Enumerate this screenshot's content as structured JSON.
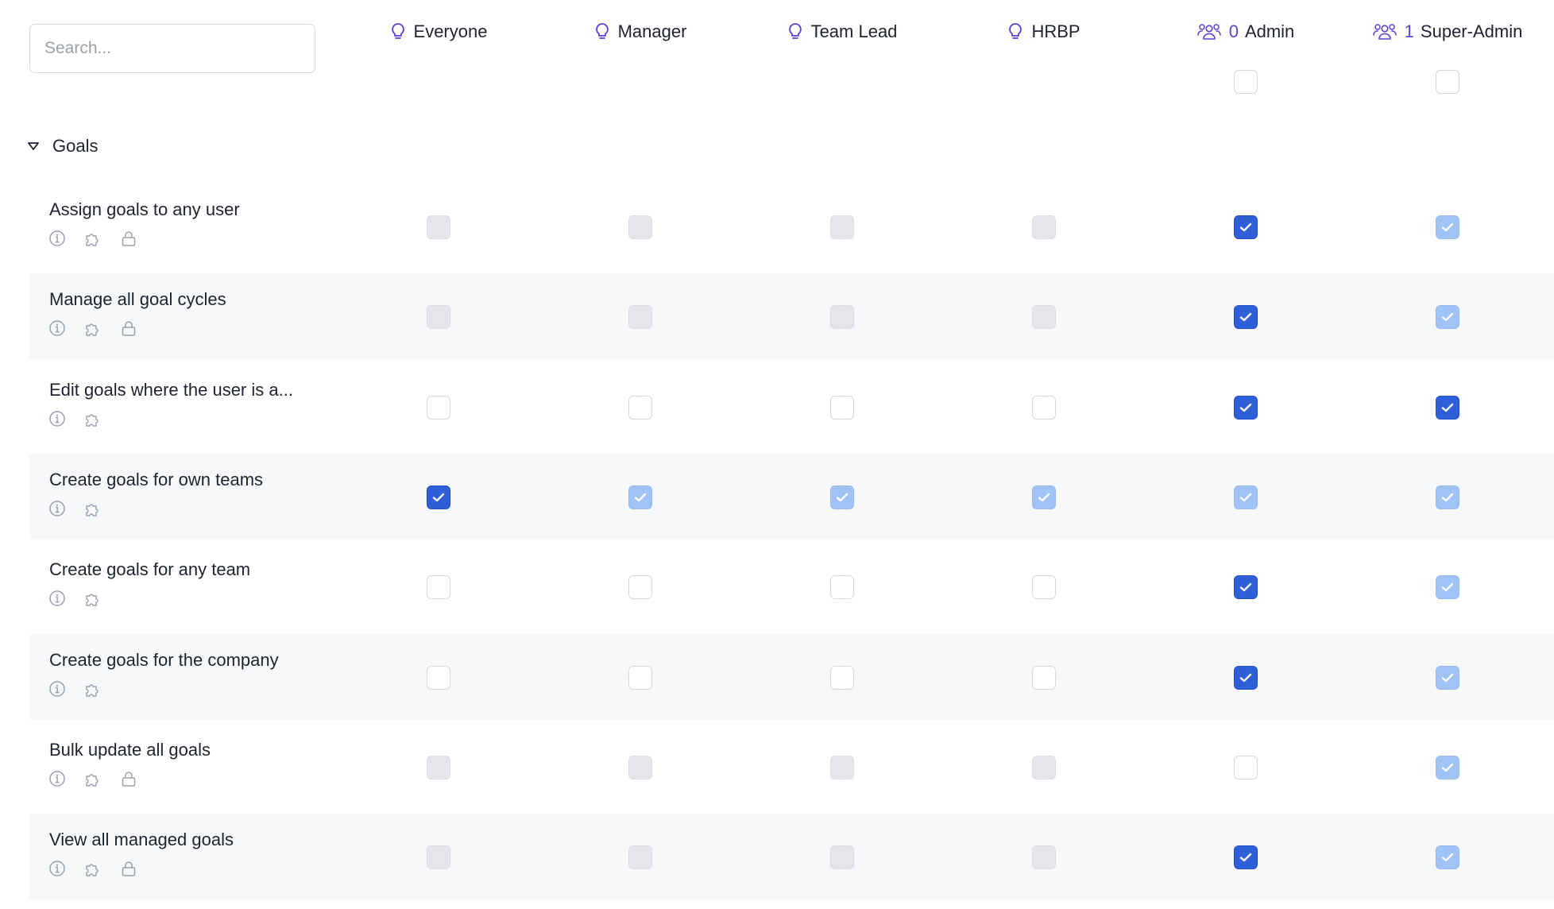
{
  "search": {
    "placeholder": "Search..."
  },
  "colors": {
    "accent_purple": "#5b3fd6",
    "checked_blue": "#2f5fd8",
    "inherited_blue": "#9fc3f5",
    "disabled_gray": "#e4e6ea",
    "row_alt_bg": "#f7f8fa"
  },
  "roles": [
    {
      "label": "Everyone",
      "icon": "lightbulb-icon"
    },
    {
      "label": "Manager",
      "icon": "lightbulb-icon"
    },
    {
      "label": "Team Lead",
      "icon": "lightbulb-icon"
    },
    {
      "label": "HRBP",
      "icon": "lightbulb-icon"
    },
    {
      "label": "Admin",
      "icon": "users-icon",
      "count": "0"
    },
    {
      "label": "Super-Admin",
      "icon": "users-icon",
      "count": "1"
    }
  ],
  "header_checkboxes": [
    {
      "role": "Admin",
      "state": "empty"
    },
    {
      "role": "Super-Admin",
      "state": "empty"
    }
  ],
  "section": {
    "title": "Goals",
    "expanded": true,
    "icon": "caret-down-icon"
  },
  "permissions": [
    {
      "label": "Assign goals to any user",
      "icons": [
        "info-icon",
        "puzzle-icon",
        "lock-icon"
      ],
      "states": [
        "disabled",
        "disabled",
        "disabled",
        "disabled",
        "checked",
        "inherited"
      ]
    },
    {
      "label": "Manage all goal cycles",
      "icons": [
        "info-icon",
        "puzzle-icon",
        "lock-icon"
      ],
      "states": [
        "disabled",
        "disabled",
        "disabled",
        "disabled",
        "checked",
        "inherited"
      ]
    },
    {
      "label": "Edit goals where the user is a...",
      "icons": [
        "info-icon",
        "puzzle-icon"
      ],
      "states": [
        "empty",
        "empty",
        "empty",
        "empty",
        "checked",
        "checked"
      ]
    },
    {
      "label": "Create goals for own teams",
      "icons": [
        "info-icon",
        "puzzle-icon"
      ],
      "states": [
        "checked",
        "inherited",
        "inherited",
        "inherited",
        "inherited",
        "inherited"
      ]
    },
    {
      "label": "Create goals for any team",
      "icons": [
        "info-icon",
        "puzzle-icon"
      ],
      "states": [
        "empty",
        "empty",
        "empty",
        "empty",
        "checked",
        "inherited"
      ]
    },
    {
      "label": "Create goals for the company",
      "icons": [
        "info-icon",
        "puzzle-icon"
      ],
      "states": [
        "empty",
        "empty",
        "empty",
        "empty",
        "checked",
        "inherited"
      ]
    },
    {
      "label": "Bulk update all goals",
      "icons": [
        "info-icon",
        "puzzle-icon",
        "lock-icon"
      ],
      "states": [
        "disabled",
        "disabled",
        "disabled",
        "disabled",
        "empty",
        "inherited"
      ]
    },
    {
      "label": "View all managed goals",
      "icons": [
        "info-icon",
        "puzzle-icon",
        "lock-icon"
      ],
      "states": [
        "disabled",
        "disabled",
        "disabled",
        "disabled",
        "checked",
        "inherited"
      ]
    }
  ]
}
